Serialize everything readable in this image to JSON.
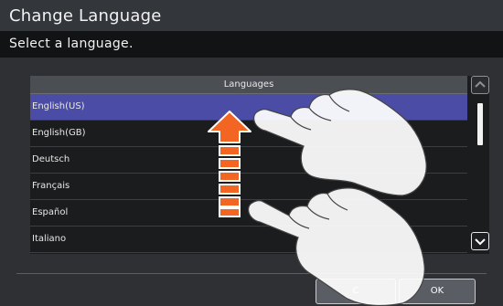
{
  "window": {
    "title": "Change Language",
    "subtitle": "Select a language."
  },
  "list": {
    "header": "Languages",
    "items": [
      {
        "label": "English(US)",
        "selected": true
      },
      {
        "label": "English(GB)",
        "selected": false
      },
      {
        "label": "Deutsch",
        "selected": false
      },
      {
        "label": "Français",
        "selected": false
      },
      {
        "label": "Español",
        "selected": false
      },
      {
        "label": "Italiano",
        "selected": false
      }
    ]
  },
  "buttons": {
    "cancel_label": "C",
    "ok_label": "OK"
  },
  "icons": {
    "scroll_up": "chevron-up-icon",
    "scroll_down": "chevron-down-icon",
    "gesture": "swipe-up-gesture-illustration"
  },
  "colors": {
    "selected_row": "#4a4ca6",
    "arrow": "#f26522"
  }
}
